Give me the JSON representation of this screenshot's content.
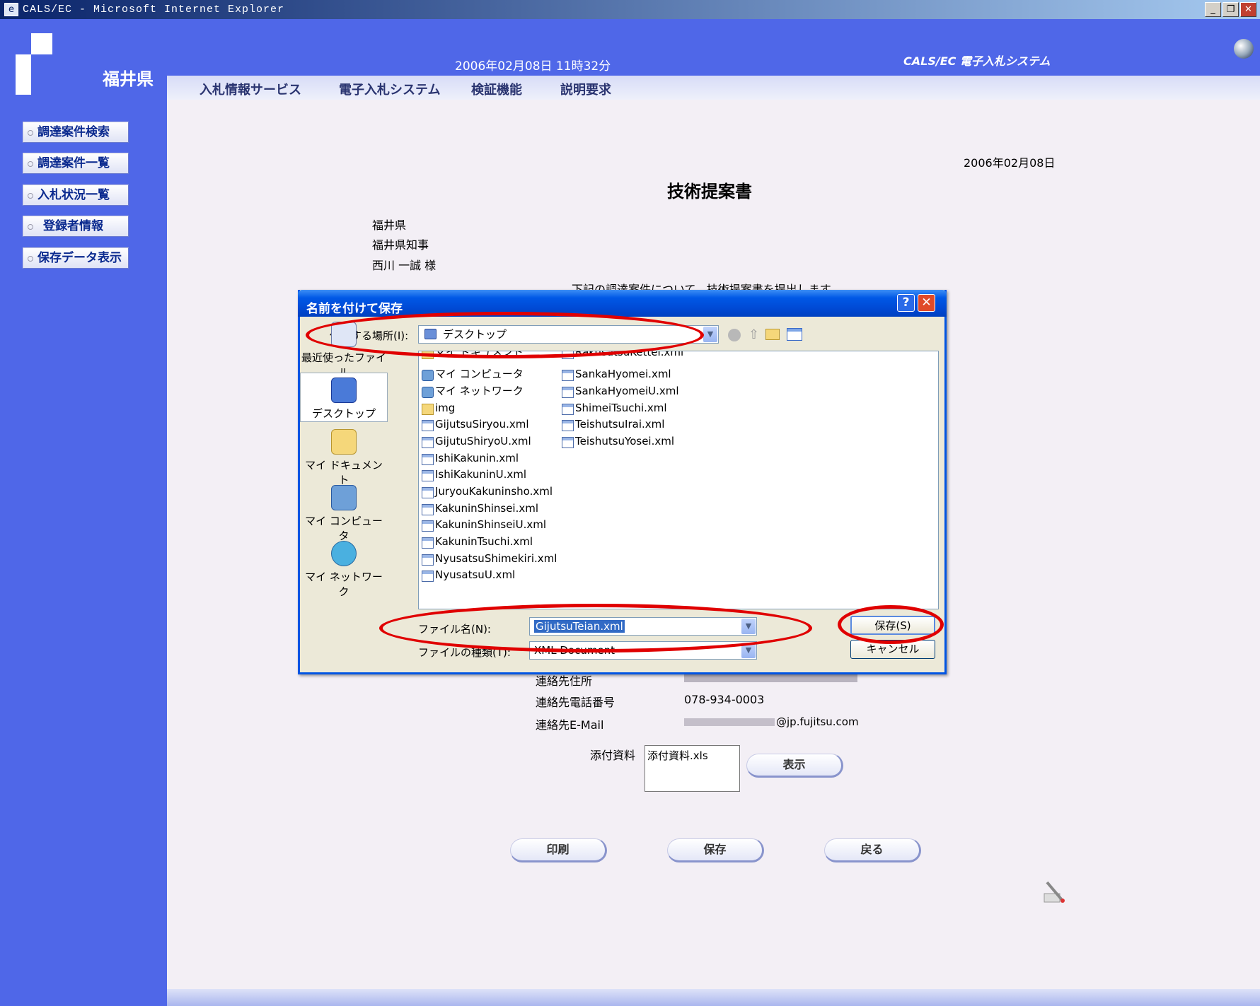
{
  "window": {
    "title": "CALS/EC - Microsoft Internet Explorer",
    "buttons": {
      "min": "_",
      "max": "❐",
      "close": "✕"
    }
  },
  "header": {
    "prefecture": "福井県",
    "datetime": "2006年02月08日 11時32分",
    "system_title": "CALS/EC 電子入札システム"
  },
  "menu": [
    "入札情報サービス",
    "電子入札システム",
    "検証機能",
    "説明要求"
  ],
  "sidebar": [
    "調達案件検索",
    "調達案件一覧",
    "入札状況一覧",
    "登録者情報",
    "保存データ表示"
  ],
  "document": {
    "date": "2006年02月08日",
    "title": "技術提案書",
    "addressee": [
      "福井県",
      "福井県知事",
      "西川 一誠 様"
    ],
    "intro_partial": "下記の調達案件について、技術提案書を提出します。",
    "contact_address_label": "連絡先住所",
    "contact_phone_label": "連絡先電話番号",
    "contact_phone": "078-934-0003",
    "contact_email_label": "連絡先E-Mail",
    "contact_email_domain": "@jp.fujitsu.com",
    "attachment_label": "添付資料",
    "attachment_file": "添付資料.xls",
    "show_button": "表示",
    "buttons": {
      "print": "印刷",
      "save": "保存",
      "back": "戻る"
    }
  },
  "dialog": {
    "title": "名前を付けて保存",
    "help": "?",
    "close": "✕",
    "save_in_label": "保存する場所(I):",
    "save_in_value": "デスクトップ",
    "places": [
      "最近使ったファイル",
      "デスクトップ",
      "マイ ドキュメント",
      "マイ コンピュータ",
      "マイ ネットワーク"
    ],
    "files_col1": [
      "マイ ドキュメント",
      "マイ コンピュータ",
      "マイ ネットワーク",
      "img",
      "GijutsuSiryou.xml",
      "GijutuShiryoU.xml",
      "IshiKakunin.xml",
      "IshiKakuninU.xml",
      "JuryouKakuninsho.xml",
      "KakuninShinsei.xml",
      "KakuninShinseiU.xml",
      "KakuninTsuchi.xml",
      "NyusatsuShimekiri.xml",
      "NyusatsuU.xml"
    ],
    "files_col2": [
      "RakusatsuKettei.xml",
      "SankaHyomei.xml",
      "SankaHyomeiU.xml",
      "ShimeiTsuchi.xml",
      "TeishutsuIrai.xml",
      "TeishutsuYosei.xml"
    ],
    "filename_label": "ファイル名(N):",
    "filename_value": "GijutsuTeian.xml",
    "filetype_label": "ファイルの種類(T):",
    "filetype_value": "XML Document",
    "save_button": "保存(S)",
    "cancel_button": "キャンセル"
  },
  "colors": {
    "nav_blue": "#4f67e8",
    "dialog_title": "#0058e6",
    "highlight_red": "#e00000"
  }
}
